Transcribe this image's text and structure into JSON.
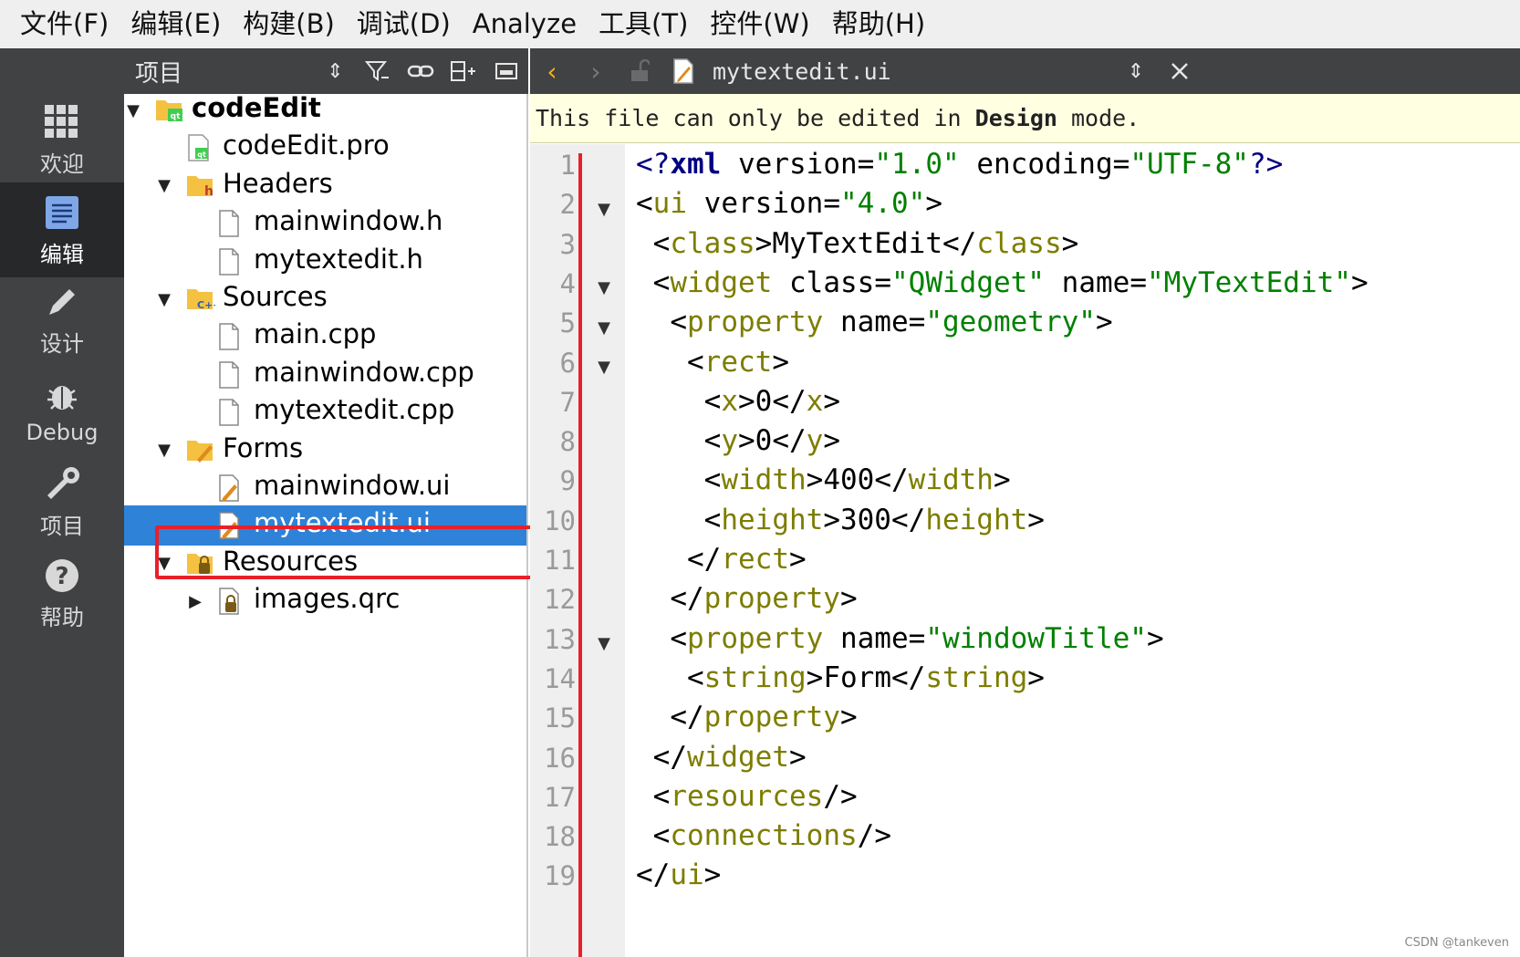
{
  "menu": [
    "文件(F)",
    "编辑(E)",
    "构建(B)",
    "调试(D)",
    "Analyze",
    "工具(T)",
    "控件(W)",
    "帮助(H)"
  ],
  "modes": [
    {
      "label": "欢迎",
      "icon": "grid-icon",
      "active": false
    },
    {
      "label": "编辑",
      "icon": "document-icon",
      "active": true
    },
    {
      "label": "设计",
      "icon": "pencil-icon",
      "active": false
    },
    {
      "label": "Debug",
      "icon": "bug-icon",
      "active": false
    },
    {
      "label": "项目",
      "icon": "wrench-icon",
      "active": false
    },
    {
      "label": "帮助",
      "icon": "help-icon",
      "active": false
    }
  ],
  "project_panel": {
    "title": "项目",
    "tree": [
      {
        "label": "codeEdit",
        "icon": "qt-project-folder-icon",
        "expanded": true
      },
      {
        "label": "codeEdit.pro",
        "icon": "qt-pro-file-icon"
      },
      {
        "label": "Headers",
        "icon": "headers-folder-icon",
        "expanded": true
      },
      {
        "label": "mainwindow.h",
        "icon": "file-icon"
      },
      {
        "label": "mytextedit.h",
        "icon": "file-icon"
      },
      {
        "label": "Sources",
        "icon": "sources-folder-icon",
        "expanded": true
      },
      {
        "label": "main.cpp",
        "icon": "file-icon"
      },
      {
        "label": "mainwindow.cpp",
        "icon": "file-icon"
      },
      {
        "label": "mytextedit.cpp",
        "icon": "file-icon"
      },
      {
        "label": "Forms",
        "icon": "forms-folder-icon",
        "expanded": true
      },
      {
        "label": "mainwindow.ui",
        "icon": "ui-file-icon"
      },
      {
        "label": "mytextedit.ui",
        "icon": "ui-file-icon",
        "selected": true
      },
      {
        "label": "Resources",
        "icon": "resources-folder-icon",
        "expanded": true
      },
      {
        "label": "images.qrc",
        "icon": "qrc-file-icon",
        "expanded": false
      }
    ]
  },
  "editor": {
    "filename": "mytextedit.ui",
    "info_prefix": "This file can only be edited in ",
    "info_strong": "Design",
    "info_suffix": " mode.",
    "lines": [
      "<?xml version=\"1.0\" encoding=\"UTF-8\"?>",
      "<ui version=\"4.0\">",
      " <class>MyTextEdit</class>",
      " <widget class=\"QWidget\" name=\"MyTextEdit\">",
      "  <property name=\"geometry\">",
      "   <rect>",
      "    <x>0</x>",
      "    <y>0</y>",
      "    <width>400</width>",
      "    <height>300</height>",
      "   </rect>",
      "  </property>",
      "  <property name=\"windowTitle\">",
      "   <string>Form</string>",
      "  </property>",
      " </widget>",
      " <resources/>",
      " <connections/>",
      "</ui>"
    ],
    "foldable_lines": [
      2,
      4,
      5,
      6,
      13
    ]
  },
  "watermark": "CSDN @tankeven",
  "colors": {
    "accent": "#2e82d7",
    "highlight_box": "#e8202a",
    "toolbar": "#404244",
    "info_bar": "#ffffe1"
  }
}
